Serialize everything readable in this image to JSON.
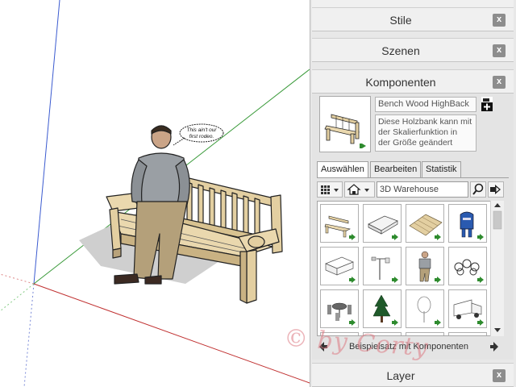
{
  "scene": {
    "speech_bubble_line1": "This ain't our",
    "speech_bubble_line2": "first rodeo."
  },
  "tray": {
    "panels": [
      {
        "title": "Stile",
        "close": "x"
      },
      {
        "title": "Szenen",
        "close": "x"
      },
      {
        "title": "Komponenten",
        "close": "x"
      },
      {
        "title": "Layer",
        "close": "x"
      }
    ],
    "component": {
      "name": "Bench Wood HighBack",
      "description_lines": [
        "Diese Holzbank kann mit",
        "der Skalierfunktion in",
        "der Größe geändert"
      ]
    },
    "tabs": [
      "Auswählen",
      "Bearbeiten",
      "Statistik"
    ],
    "search": {
      "value": "3D Warehouse"
    },
    "collection_label": "Beispielsatz mit Komponenten",
    "thumbnails": [
      "bench",
      "bed",
      "deck",
      "mailbox",
      "sofa",
      "lamp",
      "person",
      "bicycles",
      "dining set",
      "tree",
      "tree outline",
      "truck"
    ]
  },
  "watermark": "© by Corty",
  "colors": {
    "wood": "#e3cfa1",
    "wood_shadow": "#b8a27a",
    "green_arrow": "#2e8b2e",
    "axis_red": "#c03030",
    "axis_green": "#3a9a3a",
    "axis_blue": "#3b5bd0"
  }
}
